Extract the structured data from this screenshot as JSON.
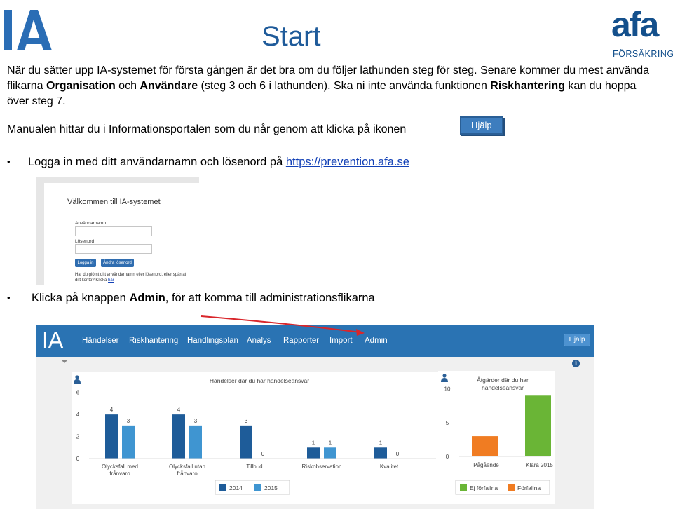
{
  "page": {
    "title": "Start",
    "intro_1": "När du sätter upp IA-systemet för första gången är det bra om du följer lathunden steg för steg. Senare kommer du mest använda flikarna ",
    "intro_tab1": "Organisation",
    "intro_och": " och ",
    "intro_tab2": "Användare",
    "intro_2": " (steg 3 och 6 i lathunden). Ska ni inte använda funktionen ",
    "intro_risk": "Riskhantering",
    "intro_3": " kan du hoppa över steg 7.",
    "manual_text": "Manualen hittar du i Informationsportalen som du når genom att klicka på ikonen",
    "help_icon_label": "Hjälp",
    "bullet_1_text": "Logga in med ditt användarnamn och lösenord på ",
    "bullet_1_link": "https://prevention.afa.se",
    "bullet_2_pre": "Klicka på knappen ",
    "bullet_2_bold": "Admin",
    "bullet_2_post": ", för att komma till administrationsflikarna"
  },
  "logos": {
    "ia": "IA",
    "afa_word": "afa",
    "afa_sub": "FÖRSÄKRING",
    "ia_color": "#2a6db5",
    "afa_color": "#14508c"
  },
  "login": {
    "title": "Välkommen till IA-systemet",
    "username_label": "Användarnamn",
    "password_label": "Lösenord",
    "login_button": "Logga in",
    "change_password_button": "Ändra lösenord",
    "forgot_text": "Har du glömt ditt användarnamn eller lösenord, eller spärrat ditt konto? Klicka ",
    "forgot_link": "här"
  },
  "app": {
    "logo": "IA",
    "nav_items": [
      "Händelser",
      "Riskhantering",
      "Handlingsplan",
      "Analys",
      "Rapporter",
      "Import",
      "Admin"
    ],
    "help_button": "Hjälp",
    "navbar_color": "#2a73b3"
  },
  "chart_data": [
    {
      "type": "bar",
      "title": "Händelser där du har händelseansvar",
      "categories": [
        "Olycksfall med frånvaro",
        "Olycksfall utan frånvaro",
        "Tillbud",
        "Riskobservation",
        "Kvalitet"
      ],
      "category_lines": [
        [
          "Olycksfall med",
          "frånvaro"
        ],
        [
          "Olycksfall utan",
          "frånvaro"
        ],
        [
          "Tillbud"
        ],
        [
          "Riskobservation"
        ],
        [
          "Kvalitet"
        ]
      ],
      "series": [
        {
          "name": "2014",
          "values": [
            4,
            4,
            3,
            1,
            1
          ],
          "color": "#1e5c99"
        },
        {
          "name": "2015",
          "values": [
            3,
            3,
            0,
            1,
            0
          ],
          "color": "#3f95d1"
        }
      ],
      "yticks": [
        0,
        2,
        4,
        6
      ],
      "ylim": [
        0,
        7
      ],
      "grid": false,
      "legend": "bottom"
    },
    {
      "type": "bar",
      "title": "Åtgärder där du har händelseansvar",
      "title_lines": [
        "Åtgärder där du har",
        "händelseansvar"
      ],
      "categories": [
        "Pågående",
        "Klara 2015"
      ],
      "values": [
        3,
        9
      ],
      "colors": [
        "#f07c22",
        "#6ab536"
      ],
      "yticks": [
        0,
        5,
        10
      ],
      "ylim": [
        0,
        11
      ],
      "legend_entries": [
        {
          "name": "Ej förfallna",
          "color": "#6ab536"
        },
        {
          "name": "Förfallna",
          "color": "#f07c22"
        }
      ],
      "grid": false,
      "legend": "bottom"
    }
  ]
}
